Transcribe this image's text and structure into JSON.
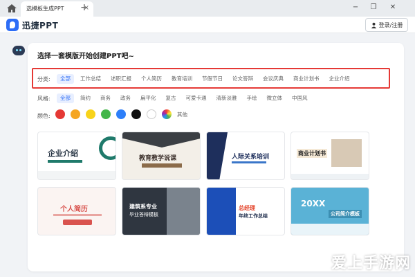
{
  "tabbar": {
    "tab_title": "选模板生成PPT",
    "close_glyph": "×",
    "new_tab_glyph": "+",
    "window_controls": [
      "−",
      "❐",
      "✕"
    ]
  },
  "appbar": {
    "brand": "迅捷PPT",
    "login_label": "登录/注册",
    "accent": "#2d6df6"
  },
  "main": {
    "heading": "选择一套模版开始创建PPT吧~",
    "category_label": "分类:",
    "categories": [
      "全部",
      "工作总结",
      "述职汇报",
      "个人简历",
      "教育培训",
      "节假节日",
      "论文答辩",
      "会议庆典",
      "商业计划书",
      "企业介绍"
    ],
    "style_label": "风格:",
    "styles": [
      "全部",
      "简约",
      "商务",
      "政务",
      "扁平化",
      "复古",
      "可爱卡通",
      "清新淡雅",
      "手绘",
      "微立体",
      "中国风"
    ],
    "color_label": "颜色:",
    "colors": [
      "#e53935",
      "#f5a623",
      "#f8d31a",
      "#43b649",
      "#2d7ff9",
      "#111111",
      "#ffffff",
      "multicolor"
    ],
    "color_other": "其他"
  },
  "templates": [
    {
      "title": "企业介绍",
      "subtitle": ""
    },
    {
      "title": "教育教学说课",
      "subtitle": ""
    },
    {
      "title": "人际关系培训",
      "subtitle": ""
    },
    {
      "title": "商业计划书",
      "subtitle": ""
    },
    {
      "title": "个人简历",
      "subtitle": ""
    },
    {
      "title": "建筑系专业",
      "subtitle": "毕业答辩模板"
    },
    {
      "title": "总经理",
      "subtitle": "年终工作总结"
    },
    {
      "title": "20XX",
      "subtitle": "公司简介模板"
    }
  ],
  "watermark": "爱上手游网"
}
